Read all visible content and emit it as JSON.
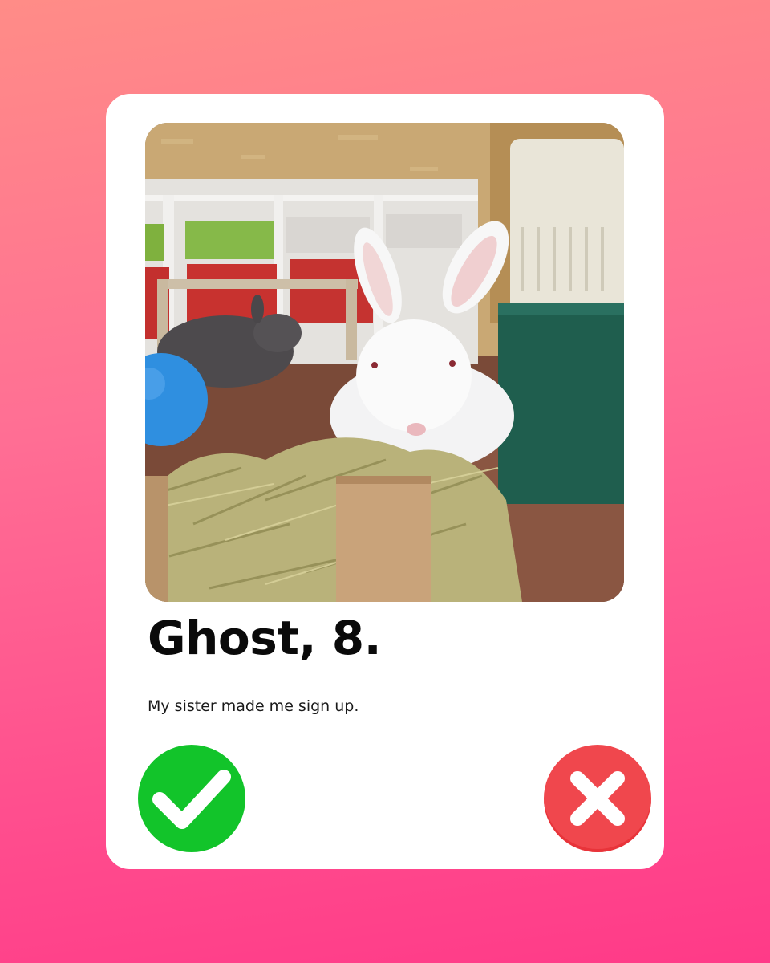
{
  "profile": {
    "name_age": "Ghost, 8.",
    "bio": "My sister made me sign up."
  },
  "actions": {
    "like_icon": "checkmark-icon",
    "dislike_icon": "close-icon"
  },
  "colors": {
    "background_top": "#ff8c87",
    "background_bottom": "#ff3a88",
    "card": "#ffffff",
    "like": "#12c42a",
    "dislike": "#f0474d"
  }
}
